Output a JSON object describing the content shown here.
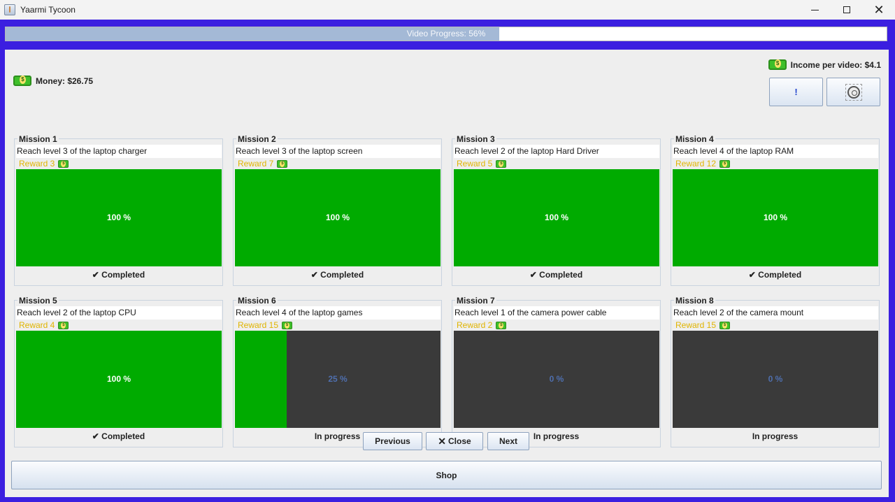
{
  "window": {
    "title": "Yaarmi Tycoon",
    "minimize_icon": "minimize-icon",
    "maximize_icon": "maximize-icon",
    "close_glyph": "✕"
  },
  "video_progress": {
    "label": "Video Progress: 56%",
    "fraction": 0.56
  },
  "stats": {
    "money": "Money: $26.75",
    "income": "Income per video: $4.1"
  },
  "toolbar": {
    "alert_label": "!",
    "settings_icon": "gear-icon"
  },
  "missions": [
    {
      "title": "Mission 1",
      "description": "Reach level 3 of the laptop charger",
      "reward": "Reward 3",
      "progress": 100,
      "percent_label": "100 %",
      "status": "✔ Completed"
    },
    {
      "title": "Mission 2",
      "description": "Reach level 3 of the laptop screen",
      "reward": "Reward 7",
      "progress": 100,
      "percent_label": "100 %",
      "status": "✔ Completed"
    },
    {
      "title": "Mission 3",
      "description": "Reach level 2 of the laptop Hard Driver",
      "reward": "Reward 5",
      "progress": 100,
      "percent_label": "100 %",
      "status": "✔ Completed"
    },
    {
      "title": "Mission 4",
      "description": "Reach level 4 of the laptop RAM",
      "reward": "Reward 12",
      "progress": 100,
      "percent_label": "100 %",
      "status": "✔ Completed"
    },
    {
      "title": "Mission 5",
      "description": "Reach level 2 of the laptop CPU",
      "reward": "Reward 4",
      "progress": 100,
      "percent_label": "100 %",
      "status": "✔ Completed"
    },
    {
      "title": "Mission 6",
      "description": "Reach level 4 of the laptop games",
      "reward": "Reward 15",
      "progress": 25,
      "percent_label": "25 %",
      "status": "In progress"
    },
    {
      "title": "Mission 7",
      "description": "Reach level 1 of the camera power cable",
      "reward": "Reward 2",
      "progress": 0,
      "percent_label": "0 %",
      "status": "In progress"
    },
    {
      "title": "Mission 8",
      "description": "Reach level 2 of the camera mount",
      "reward": "Reward 15",
      "progress": 0,
      "percent_label": "0 %",
      "status": "In progress"
    }
  ],
  "nav": {
    "previous": "Previous",
    "close": "Close",
    "close_glyph": "✕",
    "next": "Next"
  },
  "shop": {
    "label": "Shop"
  },
  "colors": {
    "frame": "#3b1fe0",
    "progress_complete": "#00ab00",
    "progress_track": "#3a3a3a",
    "reward_text": "#e0b400",
    "video_fill": "#a4b9d6"
  }
}
